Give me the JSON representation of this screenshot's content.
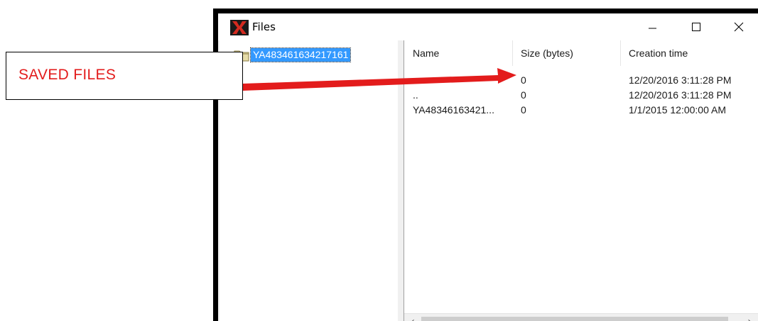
{
  "window": {
    "title": "Files",
    "app_icon": "x-app-icon",
    "controls": {
      "minimize_icon": "minimize-icon",
      "maximize_icon": "maximize-icon",
      "close_icon": "close-icon"
    }
  },
  "tree": {
    "items": [
      {
        "label": "YA483461634217161",
        "icon": "folder-icon",
        "selected": true
      }
    ]
  },
  "file_list": {
    "columns": [
      "Name",
      "Size (bytes)",
      "Creation time"
    ],
    "rows": [
      {
        "name": "",
        "size": "0",
        "created": "12/20/2016 3:11:28 PM"
      },
      {
        "name": "..",
        "size": "0",
        "created": "12/20/2016 3:11:28 PM"
      },
      {
        "name": "YA48346163421...",
        "size": "0",
        "created": "1/1/2015 12:00:00 AM"
      }
    ],
    "scrollbar": {
      "left_glyph": "‹",
      "right_glyph": "›"
    }
  },
  "annotation": {
    "label": "SAVED FILES",
    "color": "#e31c1c",
    "points_to": "size-cell-row-1"
  },
  "colors": {
    "selection": "#3399ff",
    "frame": "#000000",
    "arrow": "#e31c1c"
  }
}
